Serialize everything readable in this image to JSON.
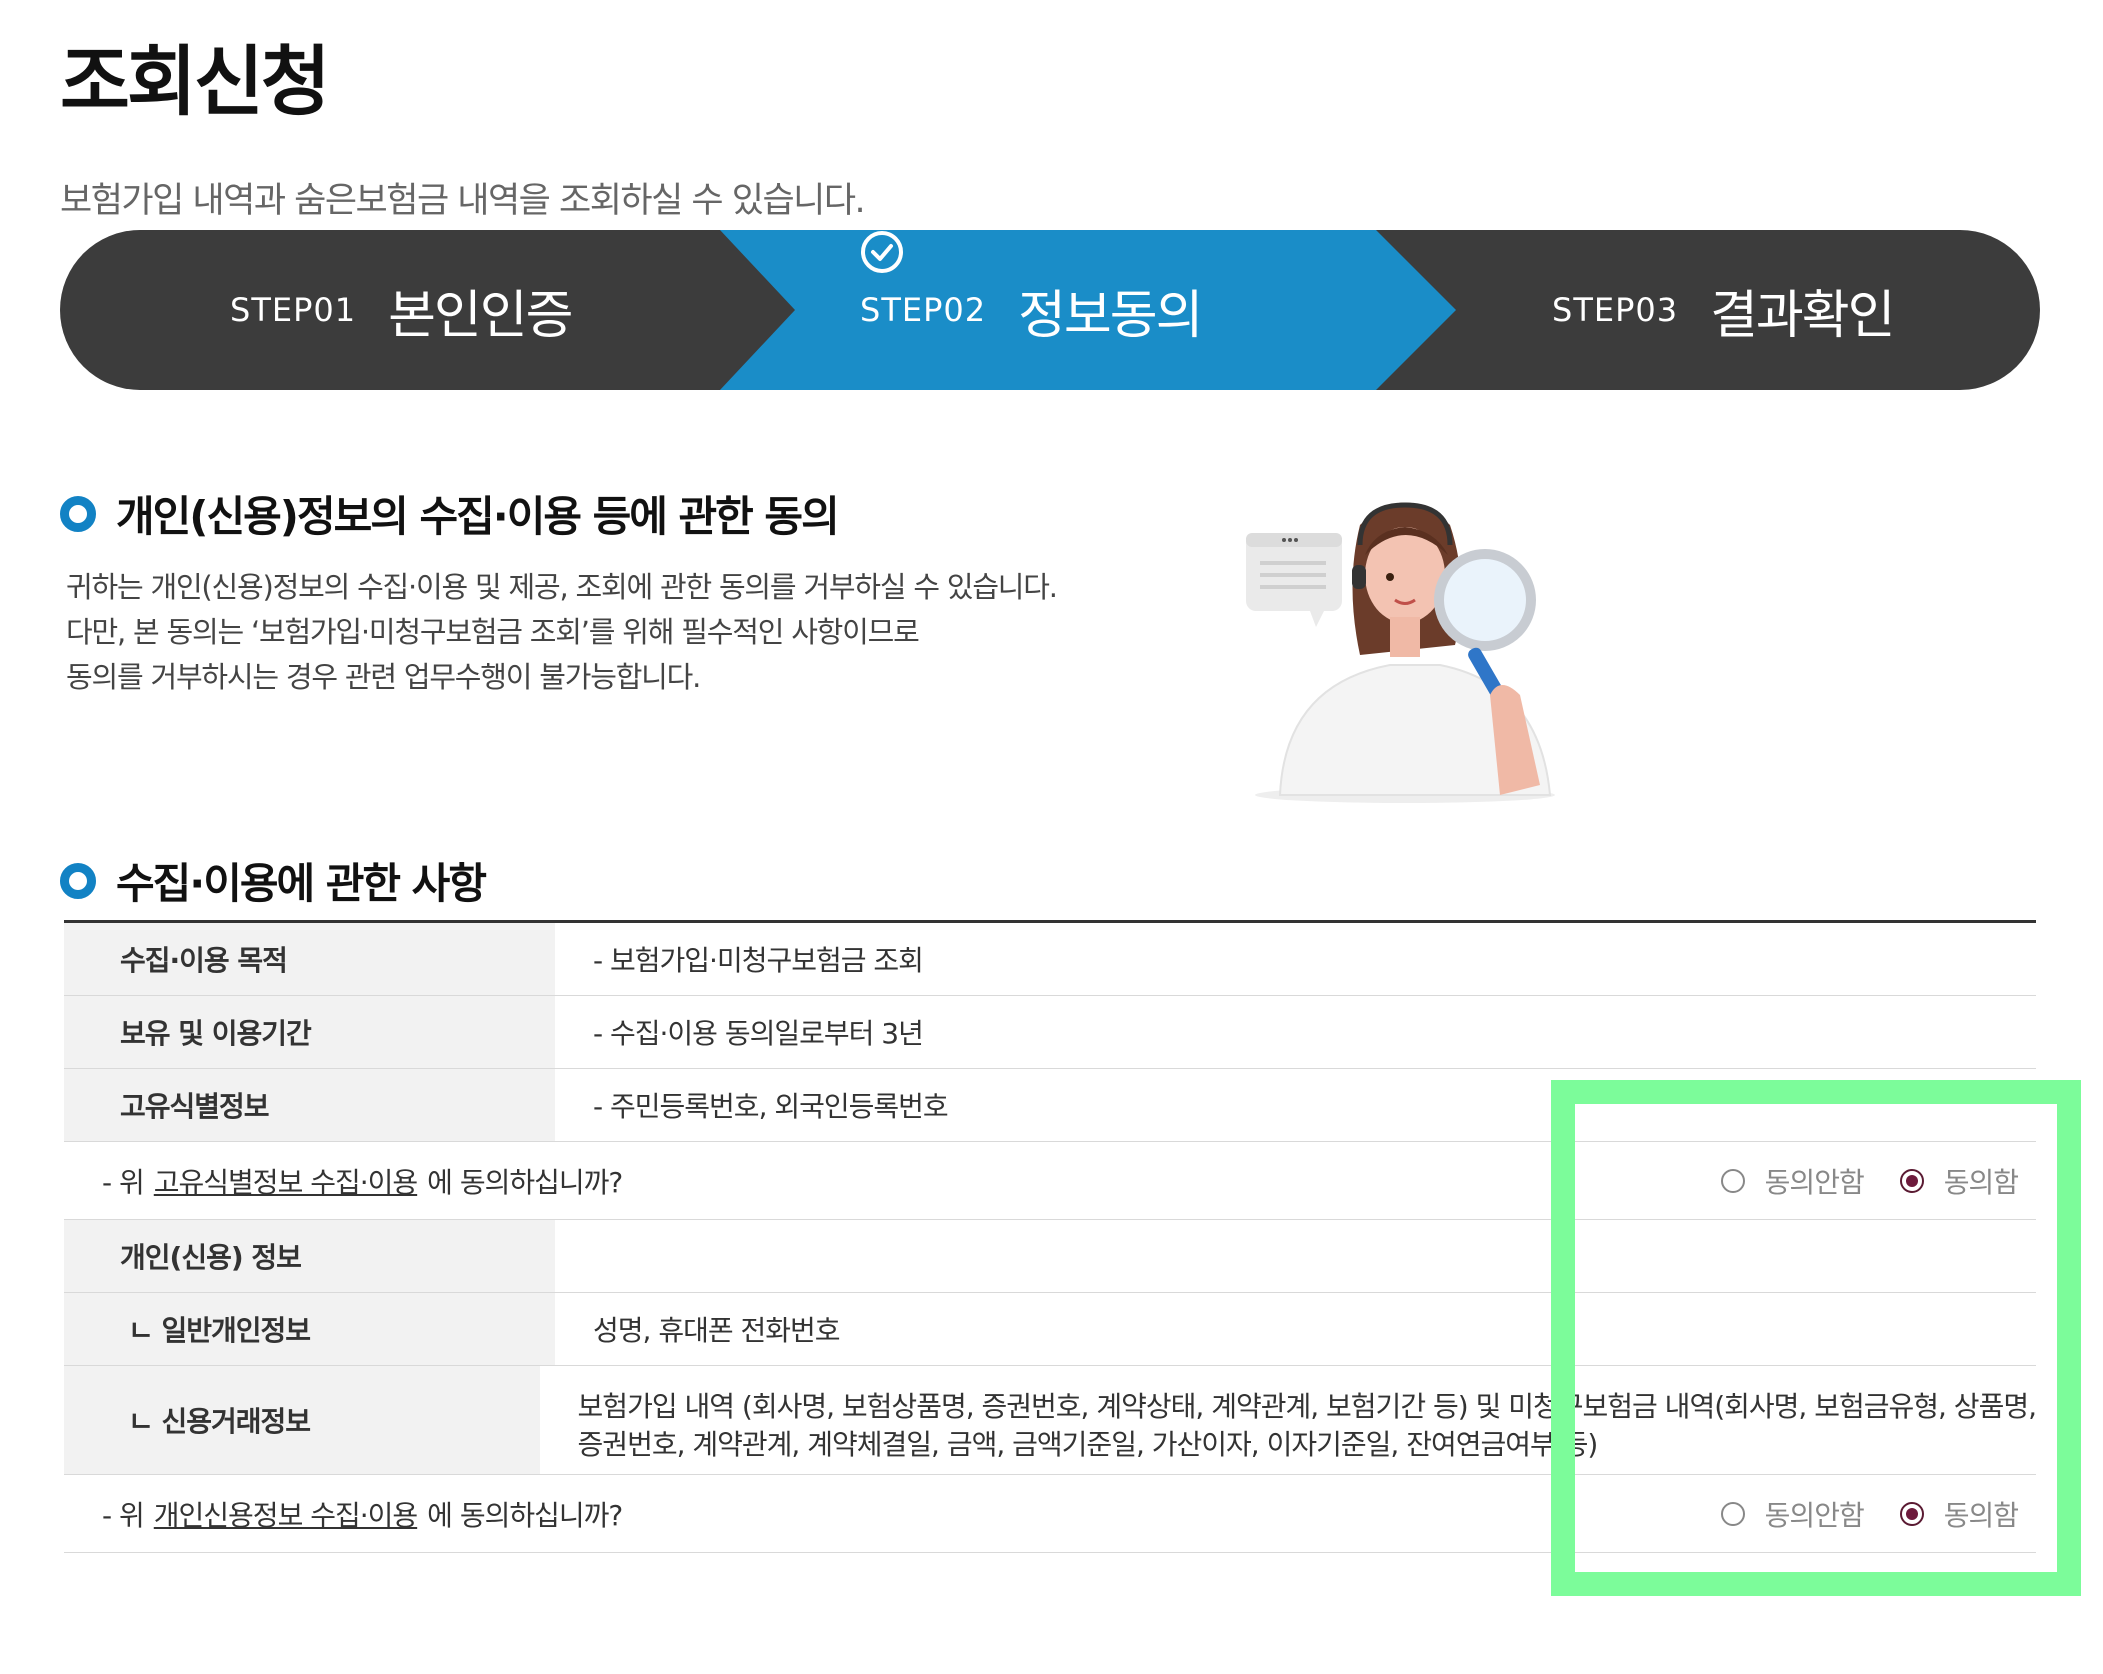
{
  "header": {
    "title": "조회신청",
    "description": "보험가입 내역과 숨은보험금 내역을 조회하실 수 있습니다."
  },
  "steps": [
    {
      "num": "STEP01",
      "label": "본인인증"
    },
    {
      "num": "STEP02",
      "label": "정보동의",
      "icon": "check-circle-icon"
    },
    {
      "num": "STEP03",
      "label": "결과확인"
    }
  ],
  "colors": {
    "active_step": "#1a8dc8",
    "step_bar": "#3c3c3c",
    "radio_selected": "#6d1a3c",
    "highlight": "#7cfc9a"
  },
  "consent_section": {
    "title": "개인(신용)정보의 수집·이용 등에 관한 동의",
    "lines": [
      "귀하는 개인(신용)정보의 수집·이용 및 제공, 조회에 관한 동의를 거부하실 수 있습니다.",
      "다만, 본 동의는 ‘보험가입·미청구보험금 조회’를 위해 필수적인 사항이므로",
      "동의를 거부하시는 경우 관련 업무수행이 불가능합니다."
    ]
  },
  "usage_section": {
    "title": "수집·이용에 관한 사항",
    "rows": [
      {
        "label": "수집·이용 목적",
        "value": "- 보험가입·미청구보험금 조회"
      },
      {
        "label": "보유 및 이용기간",
        "value": "- 수집·이용 동의일로부터 3년"
      },
      {
        "label": "고유식별정보",
        "value": "- 주민등록번호, 외국인등록번호"
      }
    ],
    "question1": {
      "prefix": "- 위",
      "link": "고유식별정보 수집·이용",
      "suffix": "에 동의하십니까?",
      "options": [
        "동의안함",
        "동의함"
      ],
      "selected": "동의함"
    },
    "personal_info": {
      "label": "개인(신용) 정보",
      "general_label": "ㄴ 일반개인정보",
      "general_value": "성명, 휴대폰 전화번호",
      "credit_label": "ㄴ 신용거래정보",
      "credit_value_line1": "보험가입 내역 (회사명, 보험상품명, 증권번호, 계약상태, 계약관계, 보험기간 등) 및 미청구보험금 내역(회사명, 보험금유형, 상품명,",
      "credit_value_line2": "증권번호, 계약관계, 계약체결일, 금액, 금액기준일, 가산이자, 이자기준일, 잔여연금여부 등)"
    },
    "question2": {
      "prefix": "- 위",
      "link": "개인신용정보 수집·이용",
      "suffix": "에 동의하십니까?",
      "options": [
        "동의안함",
        "동의함"
      ],
      "selected": "동의함"
    }
  }
}
